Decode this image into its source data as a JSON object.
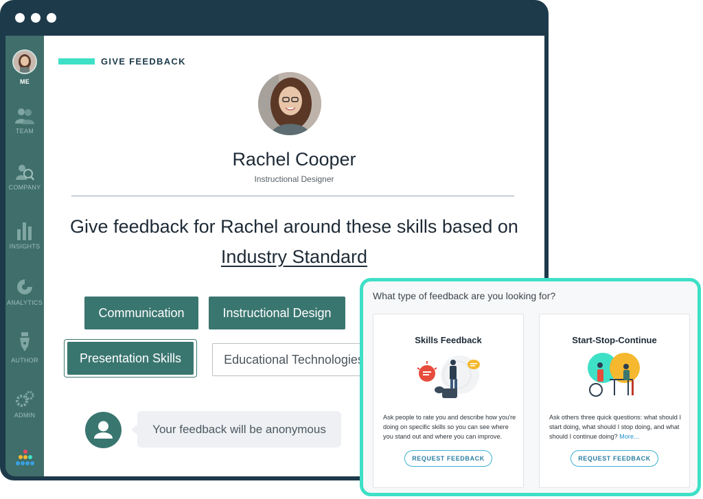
{
  "sidebar": {
    "items": [
      {
        "label": "ME",
        "icon": "avatar"
      },
      {
        "label": "TEAM",
        "icon": "team-icon"
      },
      {
        "label": "COMPANY",
        "icon": "company-search-icon"
      },
      {
        "label": "INSIGHTS",
        "icon": "bar-chart-icon"
      },
      {
        "label": "ANALYTICS",
        "icon": "pie-chart-icon"
      },
      {
        "label": "AUTHOR",
        "icon": "pen-nib-icon"
      },
      {
        "label": "ADMIN",
        "icon": "gears-icon"
      }
    ],
    "logo": "app-dots-logo"
  },
  "header": {
    "title": "GIVE FEEDBACK"
  },
  "profile": {
    "name": "Rachel Cooper",
    "role": "Instructional Designer"
  },
  "headline": {
    "text": "Give feedback for Rachel around these skills based on",
    "link": "Industry Standard"
  },
  "skills": [
    {
      "label": "Communication",
      "state": "filled"
    },
    {
      "label": "Instructional Design",
      "state": "filled"
    },
    {
      "label": "Presentation Skills",
      "state": "selected"
    },
    {
      "label": "Educational Technologies",
      "state": "outline"
    }
  ],
  "anonymous": {
    "text": "Your feedback will be anonymous"
  },
  "panel": {
    "question": "What type of feedback are you looking for?",
    "cards": [
      {
        "title": "Skills Feedback",
        "description": "Ask people to rate you and describe how you're doing on specific skills so you can see where you stand out and where you can improve.",
        "button": "REQUEST FEEDBACK"
      },
      {
        "title": "Start-Stop-Continue",
        "description": "Ask others three quick questions: what should I start doing, what should I stop doing, and what should I continue doing?",
        "more": "More...",
        "button": "REQUEST FEEDBACK"
      }
    ]
  },
  "colors": {
    "accent": "#3ee0c6",
    "primary": "#3a7670",
    "frame": "#1d3a4a",
    "sidebar": "#3f6e6b"
  }
}
